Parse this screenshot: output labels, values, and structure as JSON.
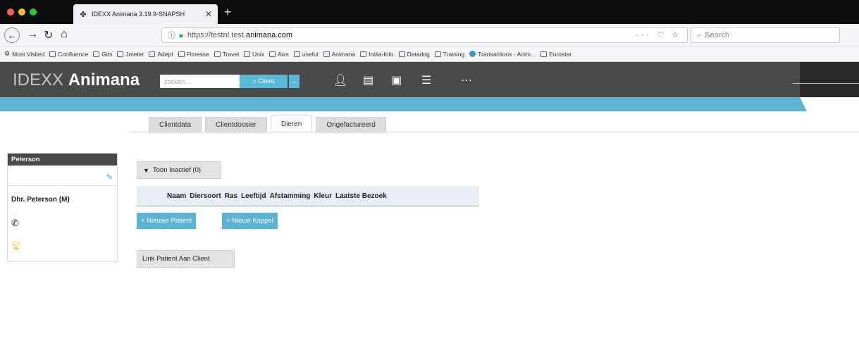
{
  "browser": {
    "tab_title": "IDEXX Animana 3.19.9-SNAPSH",
    "url_prefix": "https://testnl.test.",
    "url_domain": "animana.com",
    "url_right": "··· ♡ ☆",
    "search_placeholder": "Search"
  },
  "bookmarks": [
    {
      "label": "Most Visited",
      "icon": "gear-icon"
    },
    {
      "label": "Confluence",
      "icon": "folder-icon"
    },
    {
      "label": "Gits",
      "icon": "folder-icon"
    },
    {
      "label": "Jmeter",
      "icon": "folder-icon"
    },
    {
      "label": "Adept",
      "icon": "folder-icon"
    },
    {
      "label": "Fitnesse",
      "icon": "folder-icon"
    },
    {
      "label": "Travel",
      "icon": "folder-icon"
    },
    {
      "label": "Unix",
      "icon": "folder-icon"
    },
    {
      "label": "Aws",
      "icon": "folder-icon"
    },
    {
      "label": "useful",
      "icon": "folder-icon"
    },
    {
      "label": "Animana",
      "icon": "folder-icon"
    },
    {
      "label": "India-Info",
      "icon": "folder-icon"
    },
    {
      "label": "Datadog",
      "icon": "folder-icon"
    },
    {
      "label": "Training",
      "icon": "folder-icon"
    },
    {
      "label": "Transactions - Anim...",
      "icon": "circle-icon"
    },
    {
      "label": "Eurostar",
      "icon": "folder-icon"
    }
  ],
  "app": {
    "logo_light": "IDEXX",
    "logo_bold": "Animana",
    "search_placeholder": "zoeken...",
    "client_button": "⌕ Client",
    "client_dropdown": "⌄"
  },
  "tabs": [
    {
      "label": "Clientdata",
      "active": false
    },
    {
      "label": "Clientdossier",
      "active": false
    },
    {
      "label": "Dieren",
      "active": true
    },
    {
      "label": "Ongefactureerd",
      "active": false
    }
  ],
  "sidebar": {
    "name": "Peterson",
    "title": "Dhr. Peterson (M)"
  },
  "main": {
    "toon_inactief": "Toon Inactief (0)",
    "columns": [
      "Naam",
      "Diersoort",
      "Ras",
      "Leeftijd",
      "Afstamming",
      "Kleur",
      "Laatste Bezoek"
    ],
    "nieuwe_patient": "+ Nieuwe Patient",
    "nieuw_koppel": "+ Nieuw Koppel",
    "link_patient": "Link Patient Aan Client"
  },
  "colors": {
    "accent": "#5db3d4",
    "header": "#4a4a4a"
  }
}
